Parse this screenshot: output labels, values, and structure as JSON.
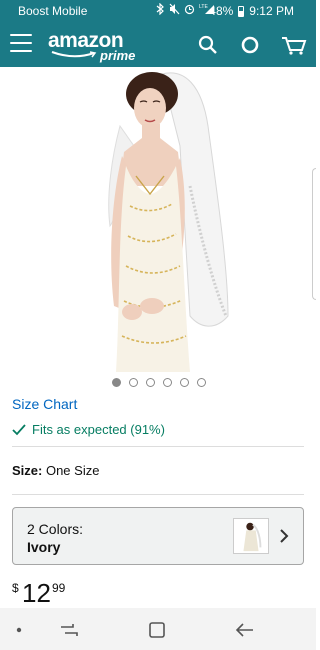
{
  "status_bar": {
    "carrier": "Boost Mobile",
    "battery": "48%",
    "time": "9:12 PM",
    "icons": [
      "bluetooth-icon",
      "mute-icon",
      "alarm-icon",
      "lte-signal-icon"
    ]
  },
  "header": {
    "logo_text": "amazon",
    "logo_subtext": "prime",
    "icons": [
      "menu-icon",
      "search-icon",
      "alexa-icon",
      "cart-icon"
    ]
  },
  "product": {
    "image_alt": "bridal veil",
    "carousel": {
      "total": 6,
      "active_index": 0
    },
    "size_chart_link": "Size Chart",
    "fit_text": "Fits as expected (91%)",
    "size_label": "Size:",
    "size_value": "One Size",
    "colors_label": "2 Colors:",
    "color_value": "Ivory",
    "price": {
      "currency": "$",
      "whole": "12",
      "fraction": "99"
    }
  },
  "nav_bar": {
    "icons": [
      "nav-dot-icon",
      "recents-icon",
      "home-icon",
      "back-icon"
    ]
  },
  "colors": {
    "header_bg": "#1b7a86",
    "link": "#0066c0",
    "fit_green": "#067d62"
  }
}
